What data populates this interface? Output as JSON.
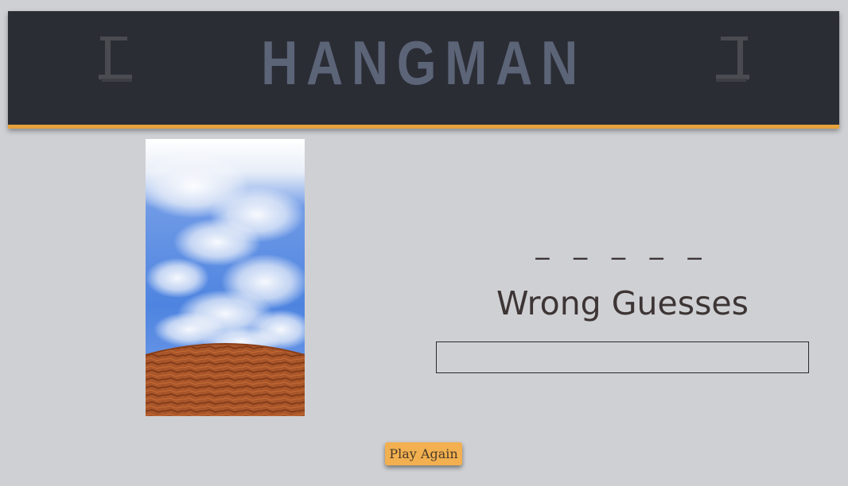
{
  "header": {
    "title": "HANGMAN"
  },
  "game": {
    "word_display": "_ _ _ _ _",
    "wrong_guesses_title": "Wrong Guesses",
    "wrong_guesses_value": ""
  },
  "controls": {
    "play_again_label": "Play Again"
  },
  "colors": {
    "header_bg": "#2b2d35",
    "accent": "#e6a23c",
    "title": "#5c6478",
    "page_bg": "#cfd0d4",
    "button": "#f2b050"
  },
  "icons": {
    "left": "gallows-icon",
    "right": "gallows-icon"
  }
}
